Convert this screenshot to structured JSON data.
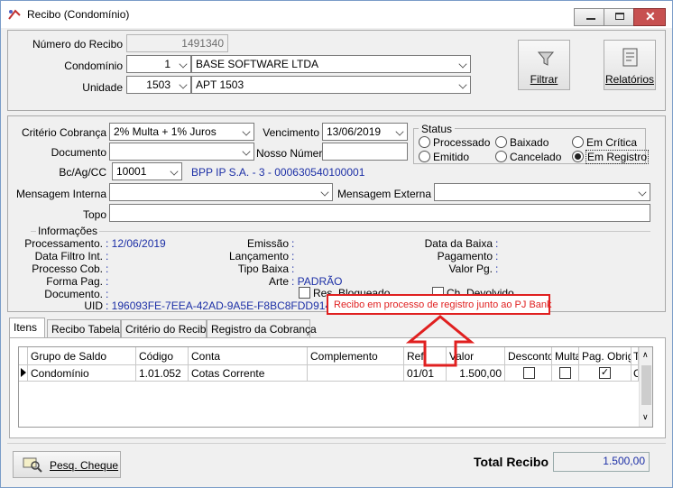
{
  "window": {
    "title": "Recibo (Condomínio)"
  },
  "header": {
    "numero_label": "Número do Recibo",
    "numero_value": "1491340",
    "condominio_label": "Condomínio",
    "condominio_code": "1",
    "condominio_name": "BASE SOFTWARE LTDA",
    "unidade_label": "Unidade",
    "unidade_code": "1503",
    "unidade_name": "APT 1503",
    "filtrar_label": "Filtrar",
    "relatorios_label": "Relatórios"
  },
  "form": {
    "criterio_label": "Critério Cobrança",
    "criterio_value": "2% Multa + 1% Juros",
    "vencimento_label": "Vencimento",
    "vencimento_value": "13/06/2019",
    "documento_label": "Documento",
    "documento_value": "",
    "nosso_numero_label": "Nosso Número",
    "nosso_numero_value": "",
    "bc_label": "Bc/Ag/CC",
    "bc_value": "10001",
    "bc_desc": "BPP IP S.A. - 3 - 000630540100001",
    "msg_interna_label": "Mensagem Interna",
    "msg_externa_label": "Mensagem Externa",
    "topo_label": "Topo"
  },
  "status": {
    "title": "Status",
    "options": [
      "Processado",
      "Baixado",
      "Em Crítica",
      "Emitido",
      "Cancelado",
      "Em Registro"
    ],
    "selected": "Em Registro"
  },
  "info": {
    "title": "Informações",
    "processamento_label": "Processamento.",
    "processamento_value": ": 12/06/2019",
    "data_filtro_label": "Data Filtro Int.",
    "data_filtro_value": ":",
    "processo_cob_label": "Processo Cob.",
    "processo_cob_value": ":",
    "forma_pag_label": "Forma Pag.",
    "forma_pag_value": ":",
    "documento_label": "Documento.",
    "documento_value": ":",
    "uid_label": "UID",
    "uid_value": ": 196093FE-7EEA-42AD-9A5E-F8BC8FDD9144",
    "emissao_label": "Emissão",
    "emissao_value": ":",
    "lancamento_label": "Lançamento",
    "lancamento_value": ":",
    "tipo_baixa_label": "Tipo Baixa",
    "tipo_baixa_value": ":",
    "arte_label": "Arte",
    "arte_value": ": PADRÃO",
    "res_bloqueado_label": "Res. Bloqueado",
    "ch_devolvido_label": "Ch. Devolvido",
    "data_baixa_label": "Data da Baixa",
    "data_baixa_value": ":",
    "pagamento_label": "Pagamento",
    "pagamento_value": ":",
    "valor_pg_label": "Valor Pg.",
    "valor_pg_value": ":"
  },
  "annotation": {
    "text": "Recibo em processo de registro junto ao PJ Bank",
    "color": "#e02020"
  },
  "tabs": [
    "Itens",
    "Recibo Tabela",
    "Critério do Recibo",
    "Registro da Cobrança"
  ],
  "grid": {
    "headers": [
      "Grupo de Saldo",
      "Código",
      "Conta",
      "Complemento",
      "Ref.",
      "Valor",
      "Desconto",
      "Multa",
      "Pag. Obrig.",
      "T"
    ],
    "rows": [
      [
        "Condomínio",
        "1.01.052",
        "Cotas Corrente",
        "",
        "01/01",
        "1.500,00",
        "",
        "",
        "",
        "C"
      ]
    ]
  },
  "footer": {
    "pesq_label": "Pesq. Cheque",
    "total_label": "Total Recibo",
    "total_value": "1.500,00"
  }
}
